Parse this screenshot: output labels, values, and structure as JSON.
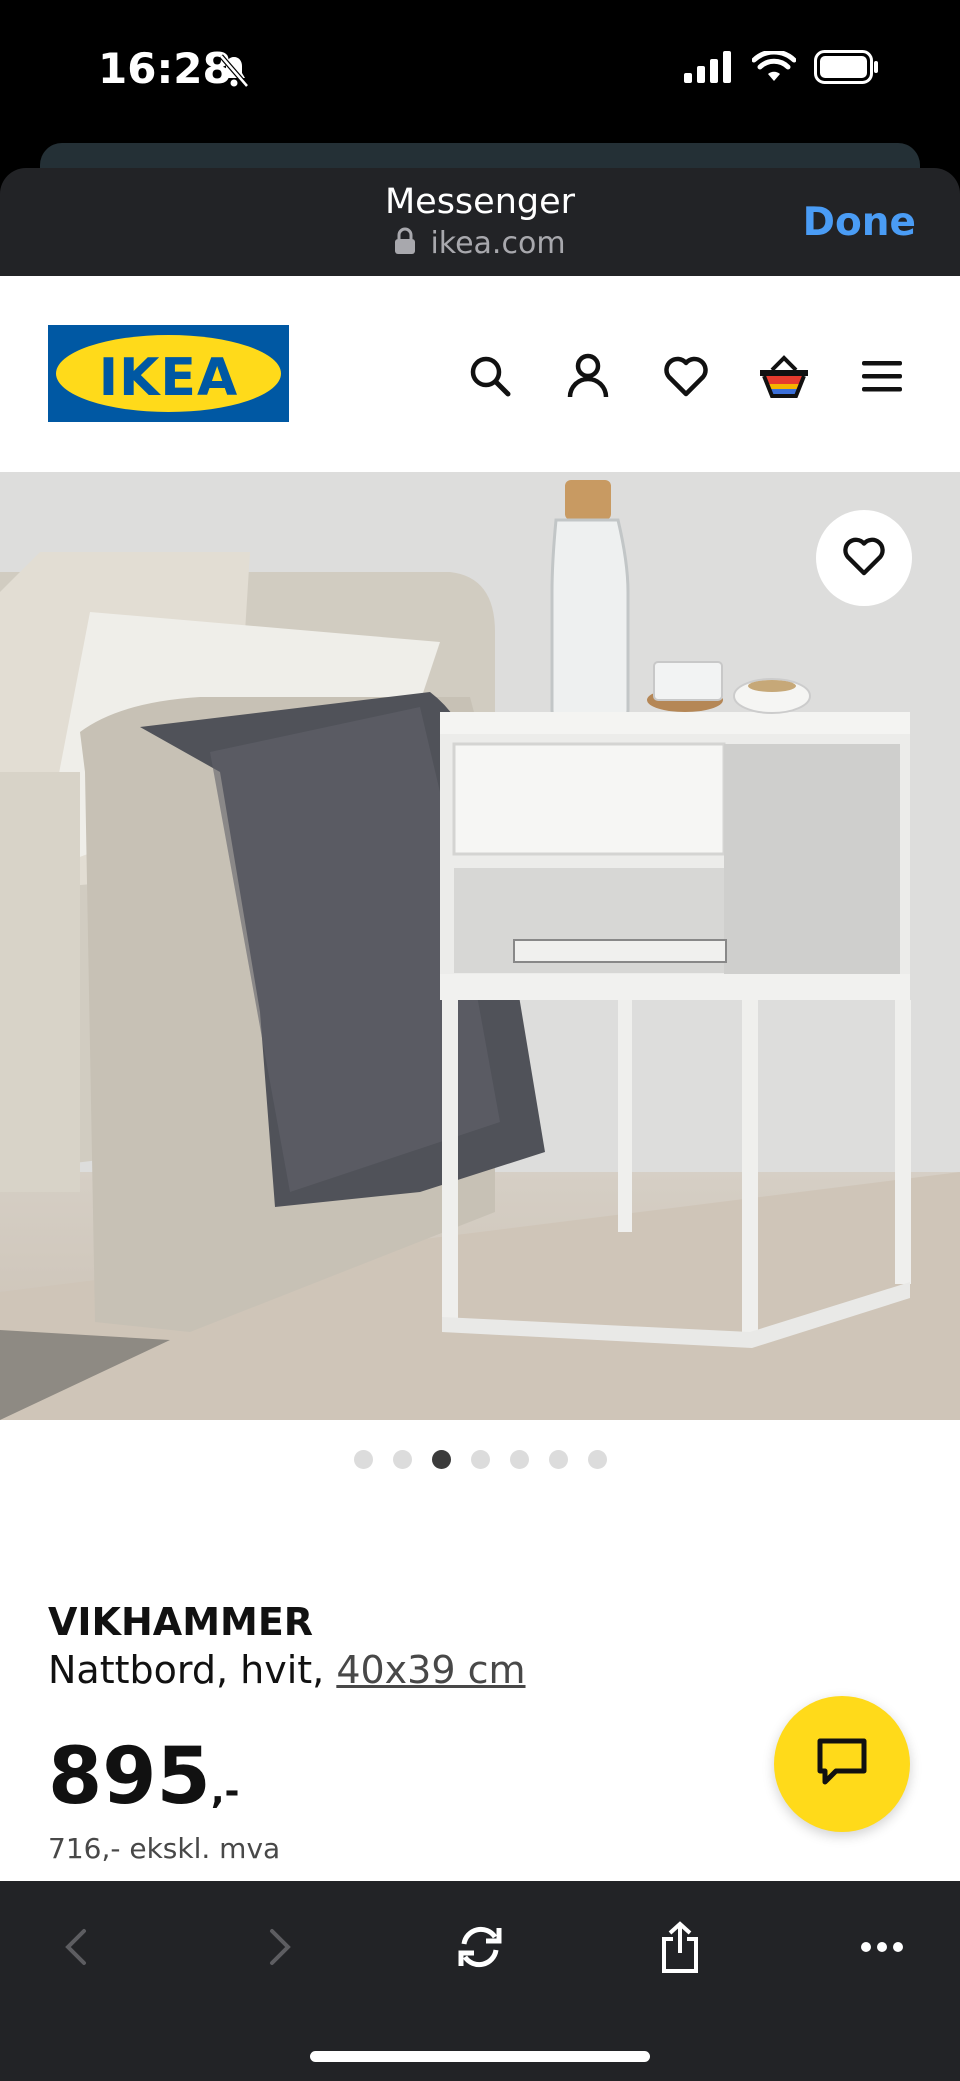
{
  "status_bar": {
    "time": "16:28"
  },
  "browser": {
    "title": "Messenger",
    "url": "ikea.com",
    "done_label": "Done"
  },
  "site": {
    "logo_text": "IKEA"
  },
  "gallery": {
    "dot_count": 7,
    "active_index": 2
  },
  "product": {
    "name": "VIKHAMMER",
    "description": "Nattbord, hvit,",
    "size_link": "40x39 cm",
    "price_amount": "895",
    "price_suffix": ",-",
    "price_ex_vat": "716,- ekskl. mva"
  },
  "colors": {
    "ikea_blue": "#0058a3",
    "ikea_yellow": "#ffda1a",
    "done_blue": "#4a9cf5",
    "toolbar": "#222326"
  }
}
